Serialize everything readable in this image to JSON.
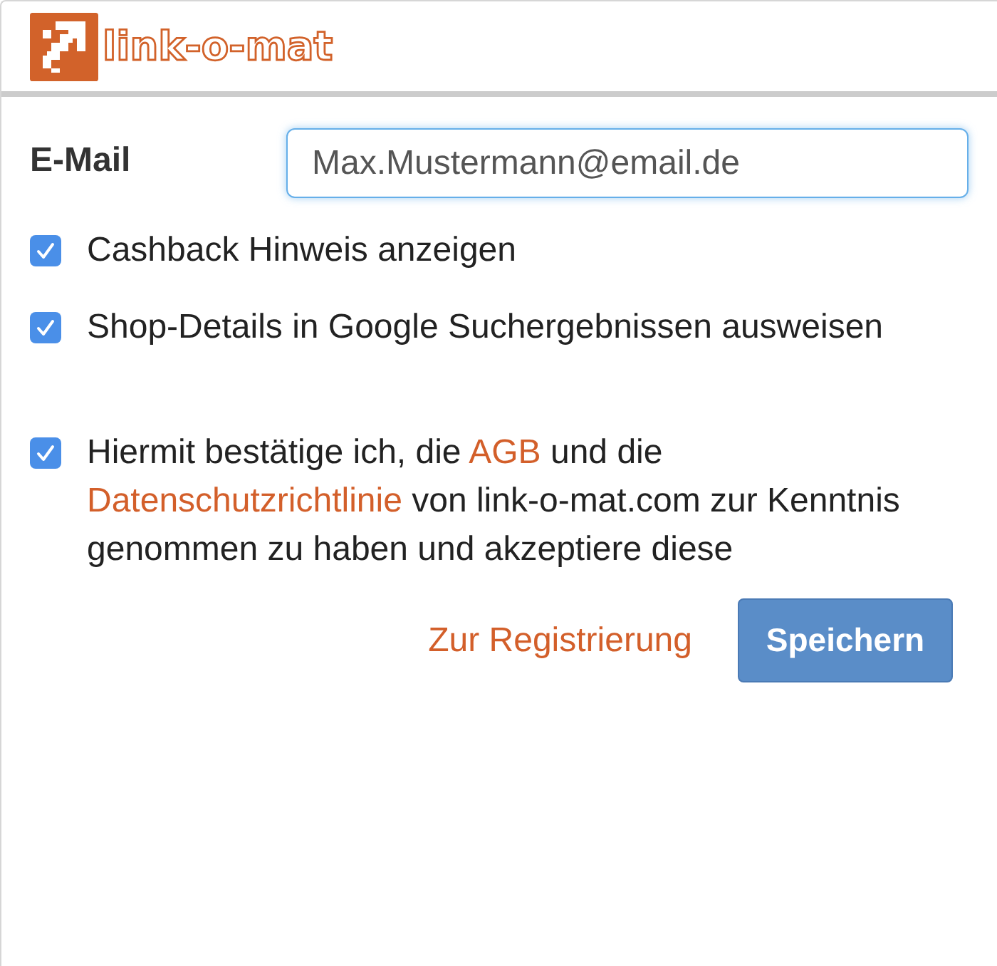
{
  "header": {
    "logo_text": "link-o-mat"
  },
  "email": {
    "label": "E-Mail",
    "value": "Max.Mustermann@email.de",
    "focused": true
  },
  "options": [
    {
      "label": "Cashback Hinweis anzeigen",
      "checked": true
    },
    {
      "label": "Shop-Details in Google Suchergebnissen ausweisen",
      "checked": true
    }
  ],
  "consent": {
    "checked": true,
    "parts": [
      {
        "kind": "text",
        "text": "Hiermit bestätige ich, die "
      },
      {
        "kind": "link",
        "text": "AGB"
      },
      {
        "kind": "text",
        "text": " und die "
      },
      {
        "kind": "link",
        "text": "Datenschutzrichtlinie"
      },
      {
        "kind": "text",
        "text": " von link-o-mat.com zur Kenntnis genommen zu haben und akzeptiere diese"
      }
    ]
  },
  "actions": {
    "register_link": "Zur Registrierung",
    "save_button": "Speichern"
  }
}
